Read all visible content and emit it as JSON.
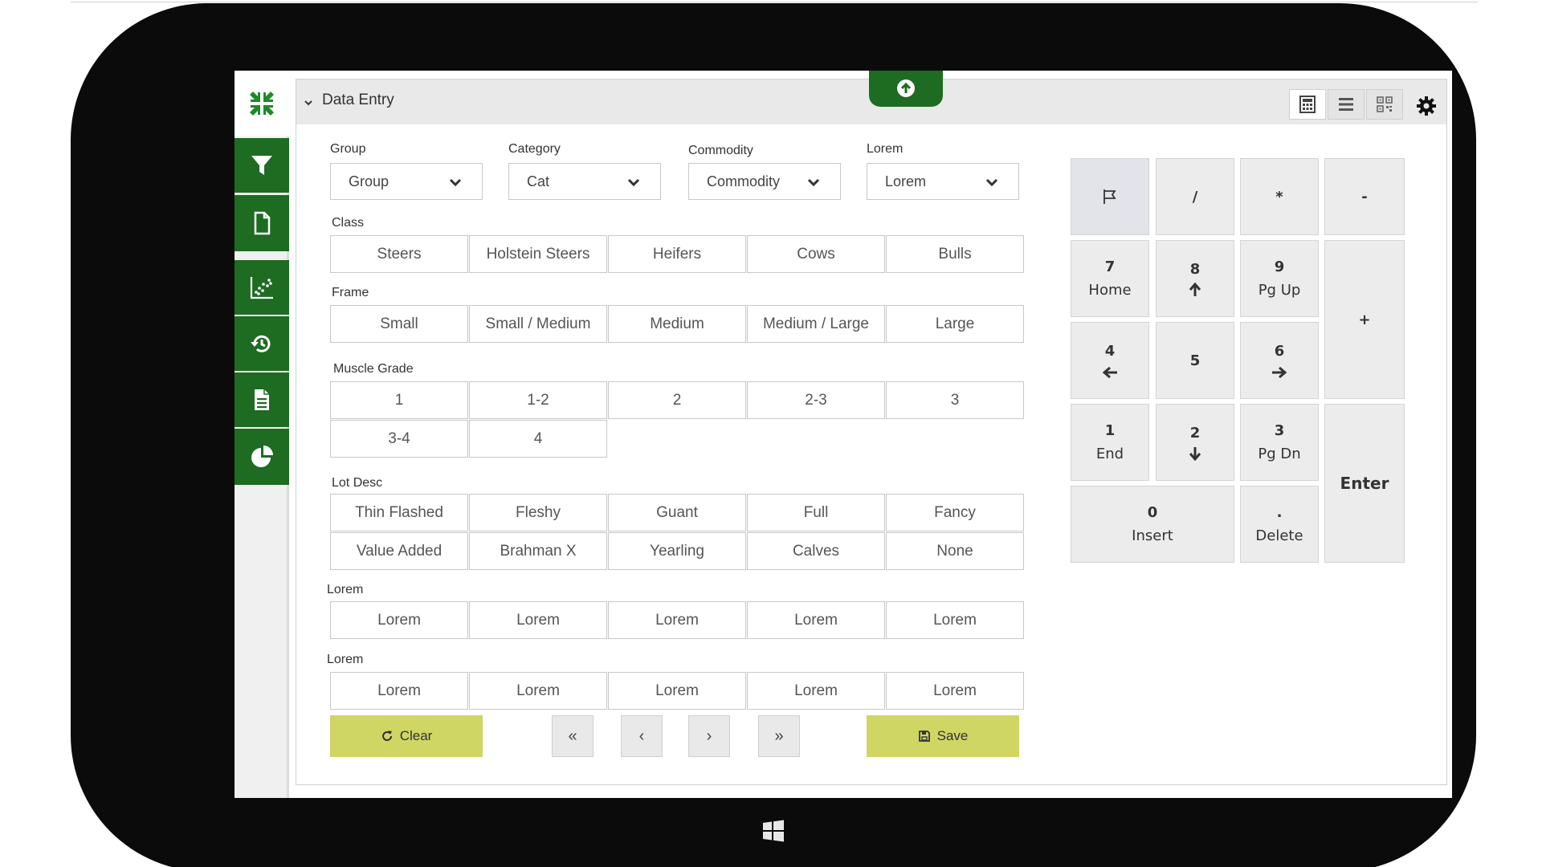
{
  "panel": {
    "title": "Data Entry"
  },
  "sidebar": {
    "items": [
      {
        "icon": "filter-icon"
      },
      {
        "icon": "document-icon"
      },
      {
        "icon": "scatter-chart-icon"
      },
      {
        "icon": "history-icon"
      },
      {
        "icon": "report-icon"
      },
      {
        "icon": "pie-chart-icon"
      }
    ]
  },
  "filters": {
    "group": {
      "label": "Group",
      "value": "Group"
    },
    "category": {
      "label": "Category",
      "value": "Cat"
    },
    "commodity": {
      "label": "Commodity",
      "value": "Commodity"
    },
    "lorem": {
      "label": "Lorem",
      "value": "Lorem"
    }
  },
  "class": {
    "label": "Class",
    "options": [
      "Steers",
      "Holstein Steers",
      "Heifers",
      "Cows",
      "Bulls"
    ]
  },
  "frame": {
    "label": "Frame",
    "options": [
      "Small",
      "Small / Medium",
      "Medium",
      "Medium / Large",
      "Large"
    ]
  },
  "muscle_grade": {
    "label": "Muscle Grade",
    "row1": [
      "1",
      "1-2",
      "2",
      "2-3",
      "3"
    ],
    "row2": [
      "3-4",
      "4"
    ]
  },
  "lot_desc": {
    "label": "Lot Desc",
    "row1": [
      "Thin Flashed",
      "Fleshy",
      "Guant",
      "Full",
      "Fancy"
    ],
    "row2": [
      "Value Added",
      "Brahman X",
      "Yearling",
      "Calves",
      "None"
    ]
  },
  "lorem1": {
    "label": "Lorem",
    "options": [
      "Lorem",
      "Lorem",
      "Lorem",
      "Lorem",
      "Lorem"
    ]
  },
  "lorem2": {
    "label": "Lorem",
    "options": [
      "Lorem",
      "Lorem",
      "Lorem",
      "Lorem",
      "Lorem"
    ]
  },
  "actions": {
    "clear": "Clear",
    "save": "Save",
    "first": "«",
    "prev": "‹",
    "next": "›",
    "last": "»"
  },
  "numpad": {
    "slash": "/",
    "star": "*",
    "minus": "-",
    "plus": "+",
    "k7": "7",
    "k7s": "Home",
    "k8": "8",
    "k9": "9",
    "k9s": "Pg Up",
    "k4": "4",
    "k5": "5",
    "k6": "6",
    "k1": "1",
    "k1s": "End",
    "k2": "2",
    "k3": "3",
    "k3s": "Pg Dn",
    "enter": "Enter",
    "k0": "0",
    "k0s": "Insert",
    "dot": ".",
    "dots": "Delete"
  },
  "colors": {
    "brand_green": "#1e6b22",
    "action_lime": "#cfd664"
  }
}
